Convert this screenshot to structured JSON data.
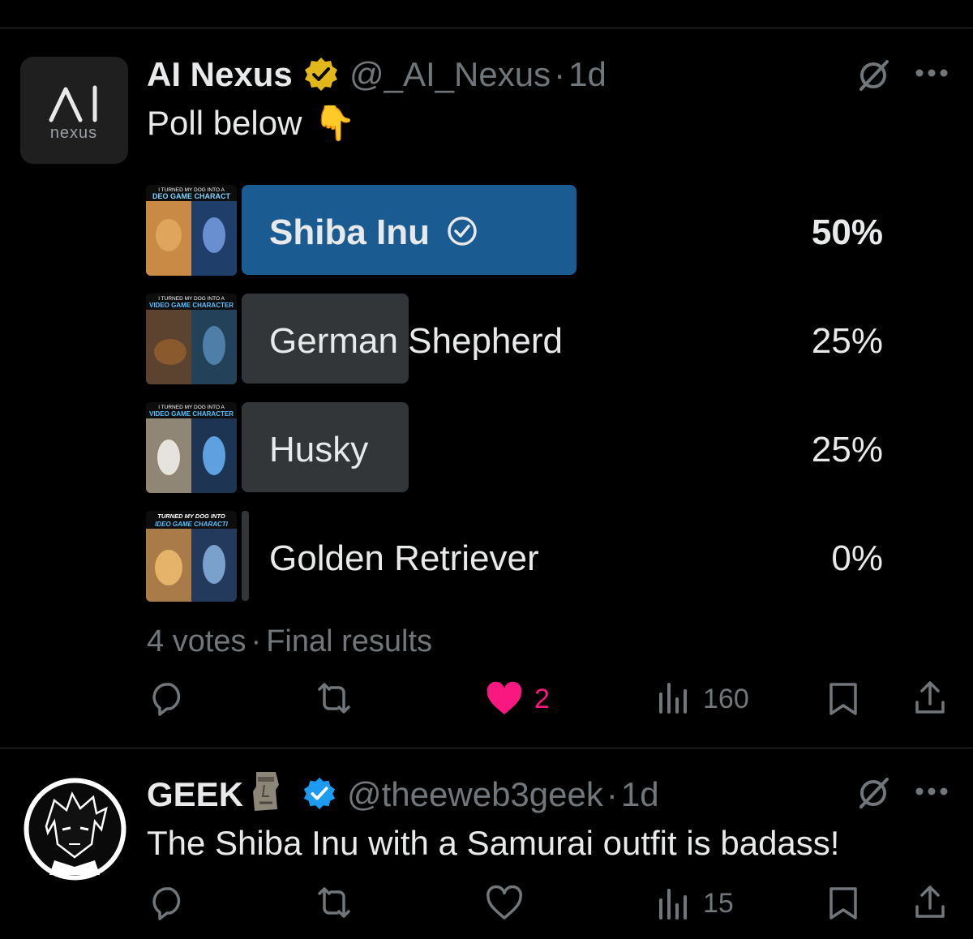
{
  "post1": {
    "display_name": "AI Nexus",
    "handle": "@_AI_Nexus",
    "separator": "·",
    "time": "1d",
    "text": "Poll below",
    "emoji": "👇",
    "avatar_text": "nexus",
    "poll": {
      "options": [
        {
          "label": "Shiba Inu",
          "percent_text": "50%",
          "percent": 50,
          "winner": true,
          "thumb_caption": [
            "I TURNED MY DOG INTO A",
            "DEO GAME CHARACT"
          ]
        },
        {
          "label": "German Shepherd",
          "percent_text": "25%",
          "percent": 25,
          "winner": false,
          "thumb_caption": [
            "I TURNED MY DOG INTO A",
            "VIDEO GAME CHARACTER"
          ]
        },
        {
          "label": "Husky",
          "percent_text": "25%",
          "percent": 25,
          "winner": false,
          "thumb_caption": [
            "I TURNED MY DOG INTO A",
            "VIDEO GAME CHARACTER"
          ]
        },
        {
          "label": "Golden Retriever",
          "percent_text": "0%",
          "percent": 0,
          "winner": false,
          "thumb_caption": [
            "TURNED MY DOG INTO",
            "IDEO GAME CHARACTI"
          ]
        }
      ],
      "votes": "4 votes",
      "separator": "·",
      "status": "Final results"
    },
    "actions": {
      "like_count": "2",
      "views_count": "160"
    }
  },
  "post2": {
    "display_name": "GEEK",
    "handle": "@theeweb3geek",
    "separator": "·",
    "time": "1d",
    "text": "The Shiba Inu with a Samurai outfit is badass!",
    "actions": {
      "views_count": "15"
    }
  },
  "colors": {
    "background": "#000000",
    "text": "#e7e9ea",
    "muted": "#71767b",
    "winner_bar": "#1a5b91",
    "loser_bar": "#333639",
    "like_pink": "#f91880",
    "verified_gold": "#e2b719",
    "verified_blue": "#1d9bf0",
    "divider": "#2f3336"
  }
}
